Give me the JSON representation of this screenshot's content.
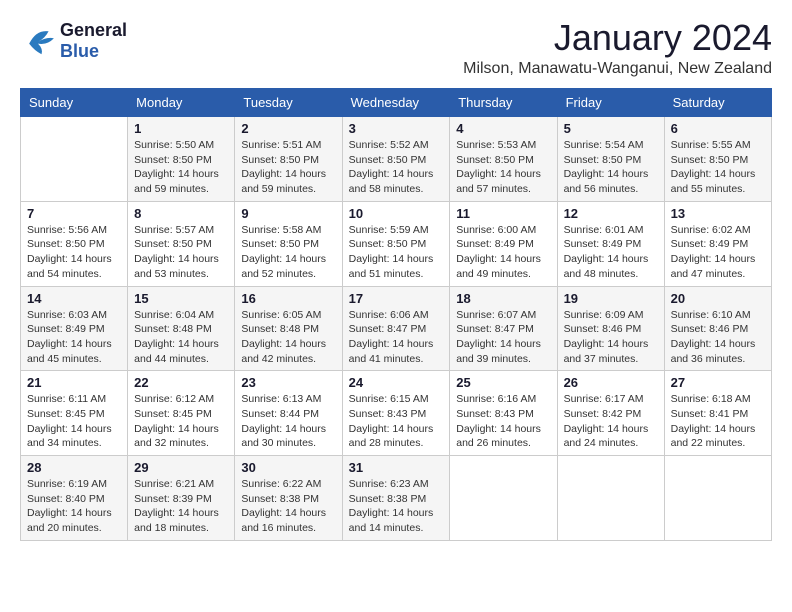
{
  "logo": {
    "line1": "General",
    "line2": "Blue"
  },
  "title": "January 2024",
  "subtitle": "Milson, Manawatu-Wanganui, New Zealand",
  "days_of_week": [
    "Sunday",
    "Monday",
    "Tuesday",
    "Wednesday",
    "Thursday",
    "Friday",
    "Saturday"
  ],
  "weeks": [
    [
      {
        "day": "",
        "sunrise": "",
        "sunset": "",
        "daylight": ""
      },
      {
        "day": "1",
        "sunrise": "Sunrise: 5:50 AM",
        "sunset": "Sunset: 8:50 PM",
        "daylight": "Daylight: 14 hours and 59 minutes."
      },
      {
        "day": "2",
        "sunrise": "Sunrise: 5:51 AM",
        "sunset": "Sunset: 8:50 PM",
        "daylight": "Daylight: 14 hours and 59 minutes."
      },
      {
        "day": "3",
        "sunrise": "Sunrise: 5:52 AM",
        "sunset": "Sunset: 8:50 PM",
        "daylight": "Daylight: 14 hours and 58 minutes."
      },
      {
        "day": "4",
        "sunrise": "Sunrise: 5:53 AM",
        "sunset": "Sunset: 8:50 PM",
        "daylight": "Daylight: 14 hours and 57 minutes."
      },
      {
        "day": "5",
        "sunrise": "Sunrise: 5:54 AM",
        "sunset": "Sunset: 8:50 PM",
        "daylight": "Daylight: 14 hours and 56 minutes."
      },
      {
        "day": "6",
        "sunrise": "Sunrise: 5:55 AM",
        "sunset": "Sunset: 8:50 PM",
        "daylight": "Daylight: 14 hours and 55 minutes."
      }
    ],
    [
      {
        "day": "7",
        "sunrise": "Sunrise: 5:56 AM",
        "sunset": "Sunset: 8:50 PM",
        "daylight": "Daylight: 14 hours and 54 minutes."
      },
      {
        "day": "8",
        "sunrise": "Sunrise: 5:57 AM",
        "sunset": "Sunset: 8:50 PM",
        "daylight": "Daylight: 14 hours and 53 minutes."
      },
      {
        "day": "9",
        "sunrise": "Sunrise: 5:58 AM",
        "sunset": "Sunset: 8:50 PM",
        "daylight": "Daylight: 14 hours and 52 minutes."
      },
      {
        "day": "10",
        "sunrise": "Sunrise: 5:59 AM",
        "sunset": "Sunset: 8:50 PM",
        "daylight": "Daylight: 14 hours and 51 minutes."
      },
      {
        "day": "11",
        "sunrise": "Sunrise: 6:00 AM",
        "sunset": "Sunset: 8:49 PM",
        "daylight": "Daylight: 14 hours and 49 minutes."
      },
      {
        "day": "12",
        "sunrise": "Sunrise: 6:01 AM",
        "sunset": "Sunset: 8:49 PM",
        "daylight": "Daylight: 14 hours and 48 minutes."
      },
      {
        "day": "13",
        "sunrise": "Sunrise: 6:02 AM",
        "sunset": "Sunset: 8:49 PM",
        "daylight": "Daylight: 14 hours and 47 minutes."
      }
    ],
    [
      {
        "day": "14",
        "sunrise": "Sunrise: 6:03 AM",
        "sunset": "Sunset: 8:49 PM",
        "daylight": "Daylight: 14 hours and 45 minutes."
      },
      {
        "day": "15",
        "sunrise": "Sunrise: 6:04 AM",
        "sunset": "Sunset: 8:48 PM",
        "daylight": "Daylight: 14 hours and 44 minutes."
      },
      {
        "day": "16",
        "sunrise": "Sunrise: 6:05 AM",
        "sunset": "Sunset: 8:48 PM",
        "daylight": "Daylight: 14 hours and 42 minutes."
      },
      {
        "day": "17",
        "sunrise": "Sunrise: 6:06 AM",
        "sunset": "Sunset: 8:47 PM",
        "daylight": "Daylight: 14 hours and 41 minutes."
      },
      {
        "day": "18",
        "sunrise": "Sunrise: 6:07 AM",
        "sunset": "Sunset: 8:47 PM",
        "daylight": "Daylight: 14 hours and 39 minutes."
      },
      {
        "day": "19",
        "sunrise": "Sunrise: 6:09 AM",
        "sunset": "Sunset: 8:46 PM",
        "daylight": "Daylight: 14 hours and 37 minutes."
      },
      {
        "day": "20",
        "sunrise": "Sunrise: 6:10 AM",
        "sunset": "Sunset: 8:46 PM",
        "daylight": "Daylight: 14 hours and 36 minutes."
      }
    ],
    [
      {
        "day": "21",
        "sunrise": "Sunrise: 6:11 AM",
        "sunset": "Sunset: 8:45 PM",
        "daylight": "Daylight: 14 hours and 34 minutes."
      },
      {
        "day": "22",
        "sunrise": "Sunrise: 6:12 AM",
        "sunset": "Sunset: 8:45 PM",
        "daylight": "Daylight: 14 hours and 32 minutes."
      },
      {
        "day": "23",
        "sunrise": "Sunrise: 6:13 AM",
        "sunset": "Sunset: 8:44 PM",
        "daylight": "Daylight: 14 hours and 30 minutes."
      },
      {
        "day": "24",
        "sunrise": "Sunrise: 6:15 AM",
        "sunset": "Sunset: 8:43 PM",
        "daylight": "Daylight: 14 hours and 28 minutes."
      },
      {
        "day": "25",
        "sunrise": "Sunrise: 6:16 AM",
        "sunset": "Sunset: 8:43 PM",
        "daylight": "Daylight: 14 hours and 26 minutes."
      },
      {
        "day": "26",
        "sunrise": "Sunrise: 6:17 AM",
        "sunset": "Sunset: 8:42 PM",
        "daylight": "Daylight: 14 hours and 24 minutes."
      },
      {
        "day": "27",
        "sunrise": "Sunrise: 6:18 AM",
        "sunset": "Sunset: 8:41 PM",
        "daylight": "Daylight: 14 hours and 22 minutes."
      }
    ],
    [
      {
        "day": "28",
        "sunrise": "Sunrise: 6:19 AM",
        "sunset": "Sunset: 8:40 PM",
        "daylight": "Daylight: 14 hours and 20 minutes."
      },
      {
        "day": "29",
        "sunrise": "Sunrise: 6:21 AM",
        "sunset": "Sunset: 8:39 PM",
        "daylight": "Daylight: 14 hours and 18 minutes."
      },
      {
        "day": "30",
        "sunrise": "Sunrise: 6:22 AM",
        "sunset": "Sunset: 8:38 PM",
        "daylight": "Daylight: 14 hours and 16 minutes."
      },
      {
        "day": "31",
        "sunrise": "Sunrise: 6:23 AM",
        "sunset": "Sunset: 8:38 PM",
        "daylight": "Daylight: 14 hours and 14 minutes."
      },
      {
        "day": "",
        "sunrise": "",
        "sunset": "",
        "daylight": ""
      },
      {
        "day": "",
        "sunrise": "",
        "sunset": "",
        "daylight": ""
      },
      {
        "day": "",
        "sunrise": "",
        "sunset": "",
        "daylight": ""
      }
    ]
  ]
}
